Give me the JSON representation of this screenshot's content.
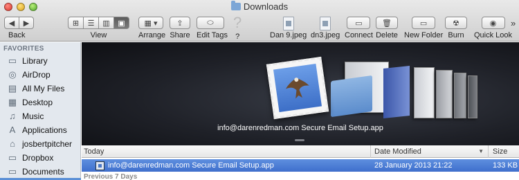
{
  "window": {
    "title": "Downloads"
  },
  "toolbar": {
    "back_label": "Back",
    "view_label": "View",
    "arrange_label": "Arrange",
    "share_label": "Share",
    "edit_tags_label": "Edit Tags",
    "help_label": "?",
    "file1_label": "Dan 9.jpeg",
    "file2_label": "dn3.jpeg",
    "connect_label": "Connect",
    "delete_label": "Delete",
    "new_folder_label": "New Folder",
    "burn_label": "Burn",
    "quick_look_label": "Quick Look",
    "overflow_label": "»"
  },
  "sidebar": {
    "header": "FAVORITES",
    "items": [
      {
        "label": "Library",
        "icon": "folder-icon"
      },
      {
        "label": "AirDrop",
        "icon": "airdrop-icon"
      },
      {
        "label": "All My Files",
        "icon": "all-files-icon"
      },
      {
        "label": "Desktop",
        "icon": "desktop-icon"
      },
      {
        "label": "Music",
        "icon": "music-icon"
      },
      {
        "label": "Applications",
        "icon": "applications-icon"
      },
      {
        "label": "josbertpitcher",
        "icon": "home-icon"
      },
      {
        "label": "Dropbox",
        "icon": "dropbox-folder-icon"
      },
      {
        "label": "Documents",
        "icon": "documents-icon"
      }
    ]
  },
  "coverflow": {
    "caption": "info@darenredman.com Secure Email Setup.app"
  },
  "list": {
    "columns": {
      "name": "Today",
      "date": "Date Modified",
      "size": "Size"
    },
    "rows": [
      {
        "name": "info@darenredman.com Secure Email Setup.app",
        "date": "28 January 2013 21:22",
        "size": "133 KB"
      }
    ],
    "group2": "Previous 7 Days"
  },
  "colors": {
    "selection": "#3f6fcc",
    "sidebar_bg": "#e3e8ee"
  }
}
